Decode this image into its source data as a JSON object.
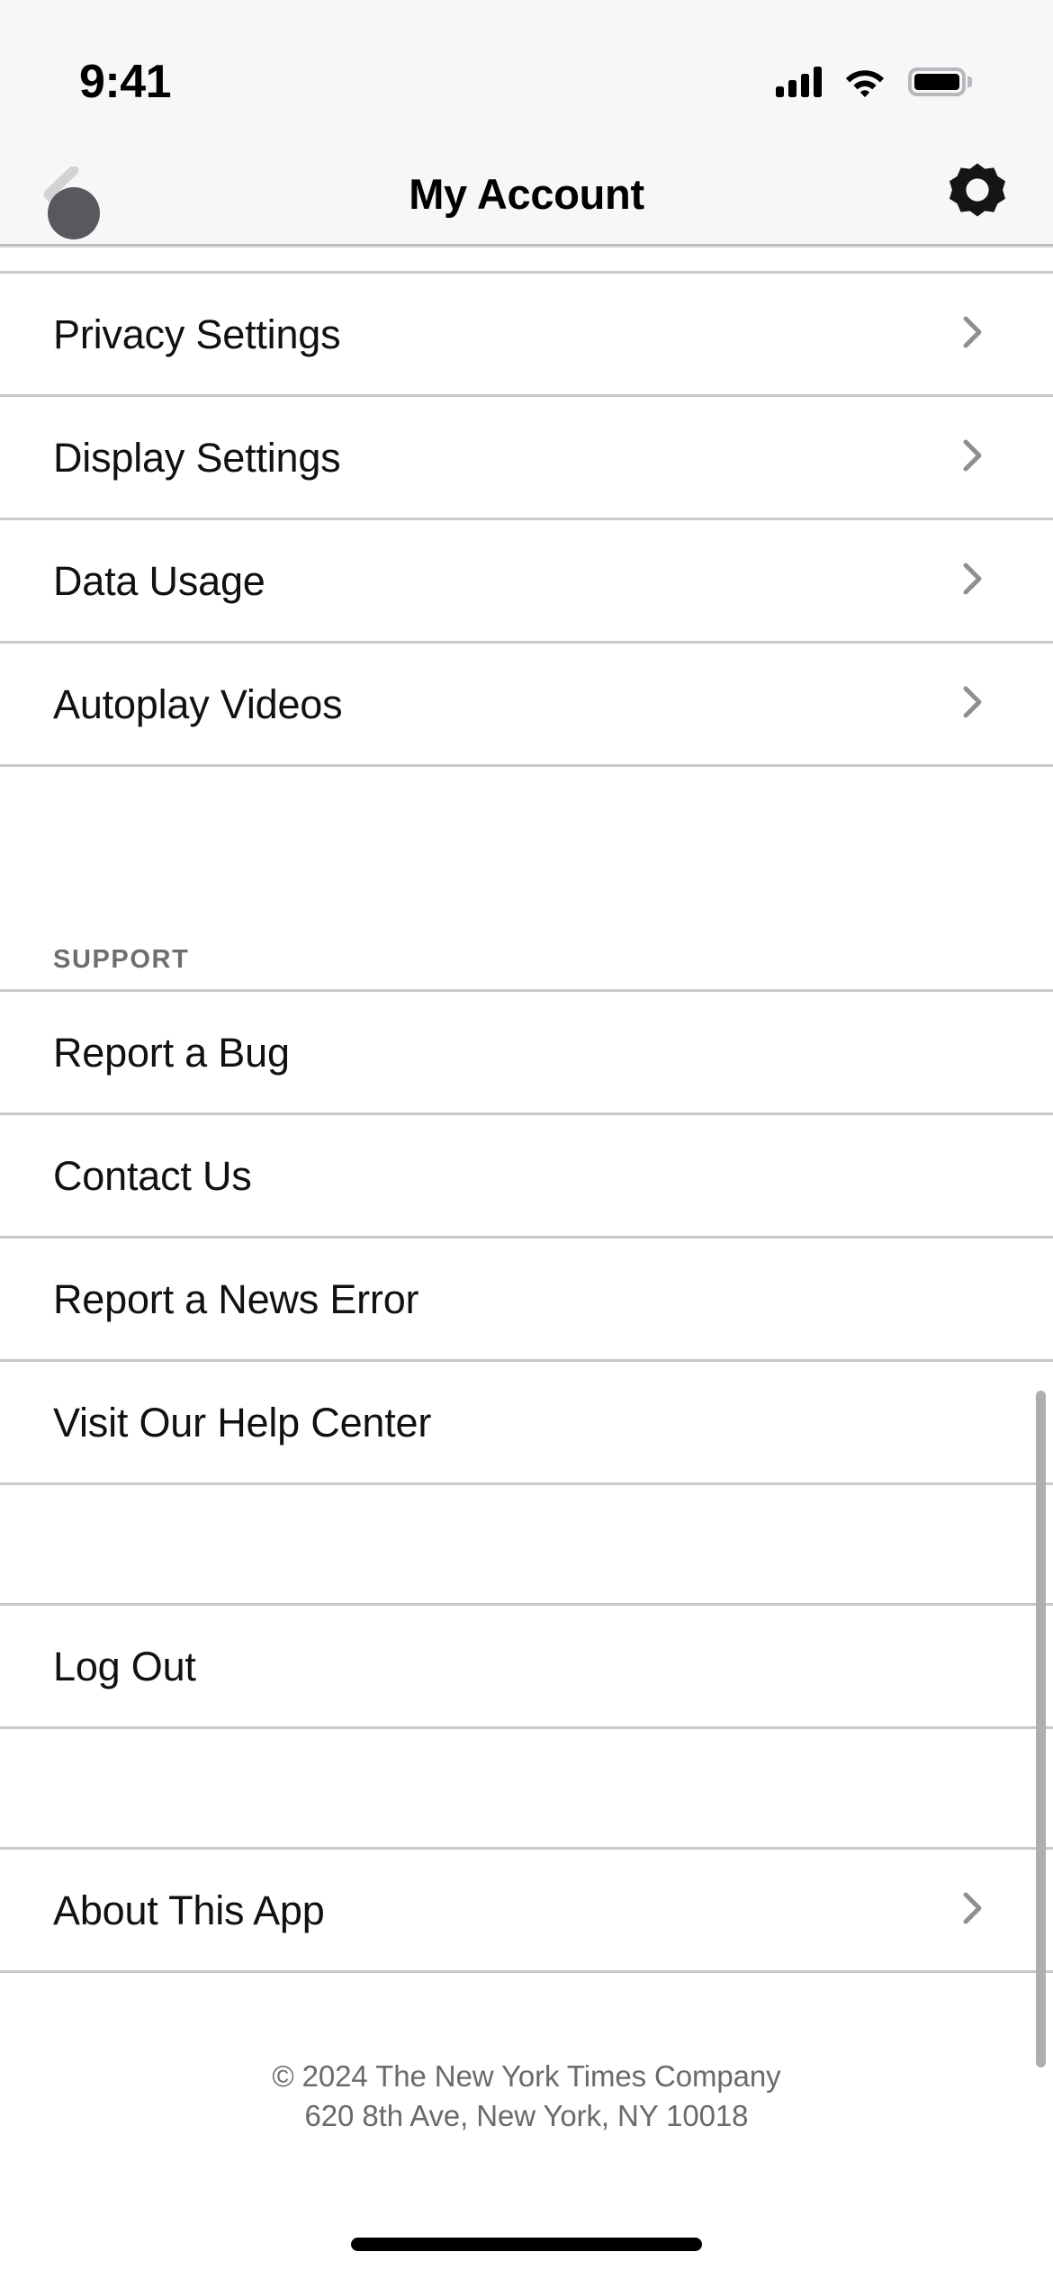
{
  "status_bar": {
    "time": "9:41",
    "cellular_icon": "signal-bars-icon",
    "wifi_icon": "wifi-icon",
    "battery_icon": "battery-full-icon"
  },
  "nav_bar": {
    "title": "My Account",
    "back_icon": "chevron-left-icon",
    "settings_icon": "gear-icon",
    "touch_indicator": "touch-point-indicator"
  },
  "settings_section": {
    "rows": [
      {
        "label": "Privacy Settings",
        "accessory": "chevron-right-icon"
      },
      {
        "label": "Display Settings",
        "accessory": "chevron-right-icon"
      },
      {
        "label": "Data Usage",
        "accessory": "chevron-right-icon"
      },
      {
        "label": "Autoplay Videos",
        "accessory": "chevron-right-icon"
      }
    ]
  },
  "support_section": {
    "header": "SUPPORT",
    "rows": [
      {
        "label": "Report a Bug"
      },
      {
        "label": "Contact Us"
      },
      {
        "label": "Report a News Error"
      },
      {
        "label": "Visit Our Help Center"
      }
    ]
  },
  "account_section": {
    "rows": [
      {
        "label": "Log Out"
      }
    ]
  },
  "about_section": {
    "rows": [
      {
        "label": "About This App",
        "accessory": "chevron-right-icon"
      }
    ]
  },
  "footer": {
    "copyright": "© 2024 The New York Times Company",
    "address": "620 8th Ave, New York, NY 10018"
  },
  "colors": {
    "chrome_background": "#f7f6f8",
    "list_background": "#ffffff",
    "separator": "#c9c9cb",
    "primary_text": "#111111",
    "secondary_text": "#6d6d72",
    "chevron": "#8e8e93",
    "scrollbar": "#aeaeb0",
    "touch_indicator": "#59585d"
  }
}
